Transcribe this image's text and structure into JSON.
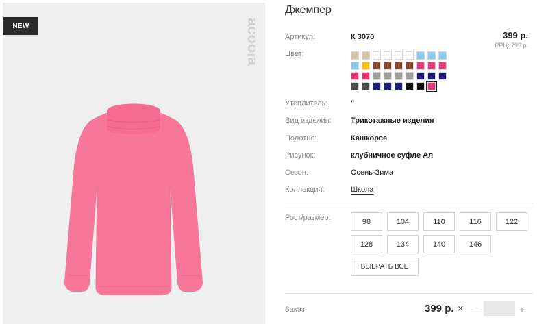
{
  "product": {
    "badge": "NEW",
    "brand_logo_text": "acoola",
    "title": "Джемпер",
    "price": "399 р.",
    "rrp": "РРЦ: 799 р.",
    "colors": {
      "primary": "#f7779b",
      "badge_bg": "#2b2b2b"
    }
  },
  "details": {
    "article": {
      "label": "Артикул:",
      "value": "К 3070"
    },
    "color": {
      "label": "Цвет:"
    },
    "insulation": {
      "label": "Утеплитель:",
      "value": "\""
    },
    "item_type": {
      "label": "Вид изделия:",
      "value": "Трикотажные изделия"
    },
    "fabric": {
      "label": "Полотно:",
      "value": "Кашкорсе"
    },
    "pattern": {
      "label": "Рисунок:",
      "value": "клубничное суфле Ал"
    },
    "season": {
      "label": "Сезон:",
      "value": "Осень-Зима"
    },
    "collection": {
      "label": "Коллекция:",
      "value": "Школа"
    }
  },
  "swatches": [
    "#d8c3a5",
    "#d8c3a5",
    "#ffffff",
    "#ffffff",
    "#ffffff",
    "#ffffff",
    "#87cbef",
    "#87cbef",
    "#87cbef",
    "#87cbef",
    "#f5c400",
    "#8b4a2d",
    "#8b4a2d",
    "#8b4a2d",
    "#8b4a2d",
    "#e8357a",
    "#e8357a",
    "#e8357a",
    "#e8357a",
    "#e8357a",
    "#9c9c9c",
    "#9c9c9c",
    "#9c9c9c",
    "#9c9c9c",
    "#1b1b7a",
    "#1b1b7a",
    "#1b1b7a",
    "#4a4a4a",
    "#4a4a4a",
    "#1b1b7a",
    "#1b1b7a",
    "#1b1b7a",
    "#111111",
    "#111111",
    "#e8357a"
  ],
  "selected_swatch_index": 34,
  "sizes": {
    "label": "Рост/размер:",
    "options": [
      "98",
      "104",
      "110",
      "116",
      "122",
      "128",
      "134",
      "140",
      "146"
    ],
    "select_all": "ВЫБРАТЬ ВСЕ"
  },
  "order": {
    "label": "Заказ:",
    "price": "399 р.",
    "times": "×",
    "minus": "–",
    "plus": "+",
    "quantity": ""
  }
}
